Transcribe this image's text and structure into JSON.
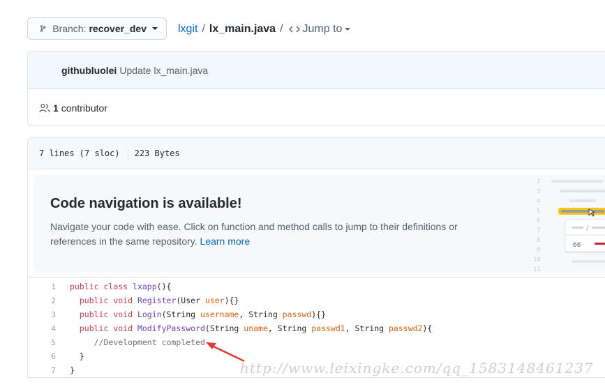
{
  "branch": {
    "label": "Branch:",
    "name": "recover_dev"
  },
  "breadcrumb": {
    "repo": "lxgit",
    "separator": "/",
    "file": "lx_main.java",
    "jump_label": "Jump to"
  },
  "commit": {
    "author": "githubluolei",
    "message": "Update lx_main.java"
  },
  "contributors": {
    "count": "1",
    "label": "contributor"
  },
  "file_info": {
    "lines": "7 lines (7 sloc)",
    "size": "223 Bytes"
  },
  "code_nav": {
    "title": "Code navigation is available!",
    "description": "Navigate your code with ease. Click on function and method calls to jump to their definitions or references in the same repository.",
    "learn_more": "Learn more",
    "illustration_numbers": [
      "2",
      "3",
      "4",
      "5",
      "6",
      "7",
      "8",
      "9",
      "10",
      "11"
    ],
    "illustration_value": "66"
  },
  "code_lines": [
    {
      "num": "1",
      "tokens": [
        [
          "kw",
          "public "
        ],
        [
          "kw",
          "class "
        ],
        [
          "fn",
          "lxapp"
        ],
        [
          "",
          "(){"
        ]
      ]
    },
    {
      "num": "2",
      "tokens": [
        [
          "",
          "  "
        ],
        [
          "kw",
          "public "
        ],
        [
          "kw",
          "void "
        ],
        [
          "fn",
          "Register"
        ],
        [
          "",
          "(User "
        ],
        [
          "var",
          "user"
        ],
        [
          "",
          ")"
        ],
        [
          "",
          "{}"
        ]
      ]
    },
    {
      "num": "3",
      "tokens": [
        [
          "",
          "  "
        ],
        [
          "kw",
          "public "
        ],
        [
          "kw",
          "void "
        ],
        [
          "fn",
          "Login"
        ],
        [
          "",
          "(String "
        ],
        [
          "var",
          "username"
        ],
        [
          "",
          ", String "
        ],
        [
          "var",
          "passwd"
        ],
        [
          "",
          ")"
        ],
        [
          "",
          "{}"
        ]
      ]
    },
    {
      "num": "4",
      "tokens": [
        [
          "",
          "  "
        ],
        [
          "kw",
          "public "
        ],
        [
          "kw",
          "void "
        ],
        [
          "fn",
          "ModifyPassword"
        ],
        [
          "",
          "(String "
        ],
        [
          "var",
          "uname"
        ],
        [
          "",
          ", String "
        ],
        [
          "var",
          "passwd1"
        ],
        [
          "",
          ", String "
        ],
        [
          "var",
          "passwd2"
        ],
        [
          "",
          "){"
        ]
      ]
    },
    {
      "num": "5",
      "tokens": [
        [
          "",
          "     "
        ],
        [
          "cm",
          "//Development completed"
        ]
      ]
    },
    {
      "num": "6",
      "tokens": [
        [
          "",
          "  }"
        ]
      ]
    },
    {
      "num": "7",
      "tokens": [
        [
          "",
          "}"
        ]
      ]
    }
  ],
  "watermark": "http://www.leixingke.com/qq_1583148461237",
  "colors": {
    "link": "#0366d6",
    "keyword": "#d73a49",
    "function": "#6f42c1",
    "variable": "#e36209",
    "comment": "#6a737d",
    "arrow": "#e53935"
  }
}
